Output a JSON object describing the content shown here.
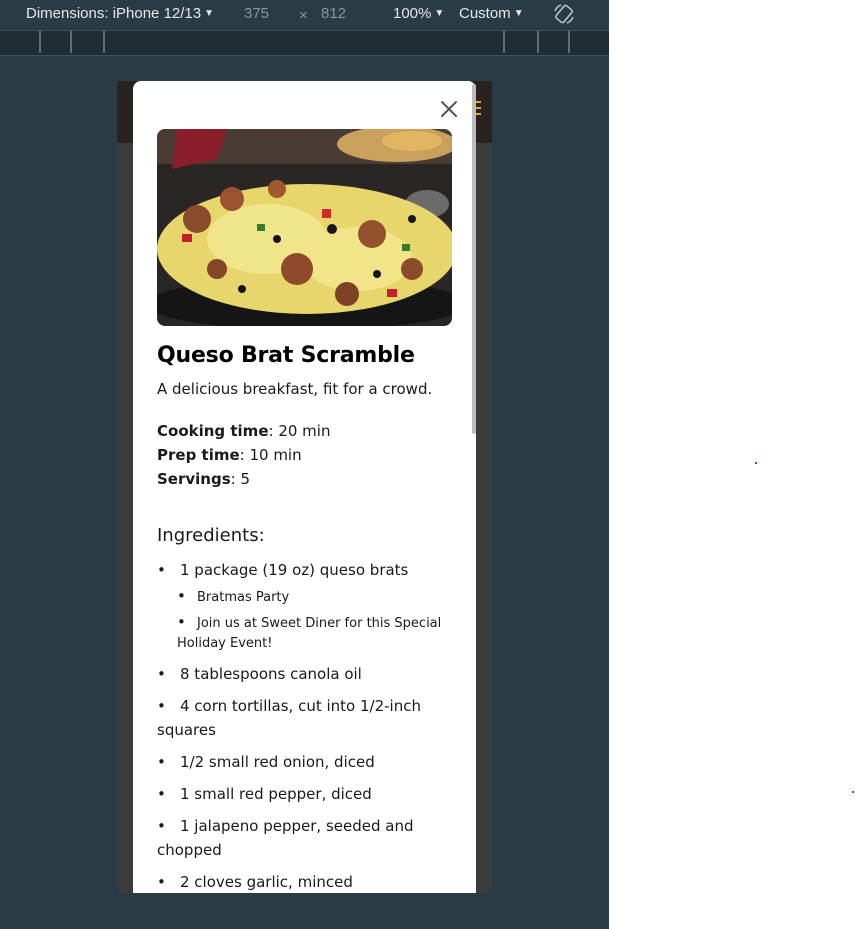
{
  "devtools": {
    "dimensions_label": "Dimensions: iPhone 12/13",
    "width": "375",
    "times": "×",
    "height": "812",
    "zoom": "100%",
    "throttle": "Custom"
  },
  "modal": {
    "title": "Queso Brat Scramble",
    "description": "A delicious breakfast, fit for a crowd.",
    "meta": [
      {
        "label": "Cooking time",
        "value": ": 20 min"
      },
      {
        "label": "Prep time",
        "value": ": 10 min"
      },
      {
        "label": "Servings",
        "value": ": 5"
      }
    ],
    "ingredients_heading": "Ingredients:",
    "ingredients": [
      "1 package (19 oz) queso brats",
      "8 tablespoons canola oil",
      "4 corn tortillas, cut into 1/2-inch squares",
      "1/2 small red onion, diced",
      "1 small red pepper, diced",
      "1 jalapeno pepper, seeded and chopped",
      "2 cloves garlic, minced"
    ],
    "sub_items": [
      "Bratmas Party",
      "Join us at Sweet Diner for this Special Holiday Event!"
    ],
    "bullet": "•"
  },
  "colors": {
    "devtools_bg": "#293b45",
    "accent": "#e2a23b"
  }
}
